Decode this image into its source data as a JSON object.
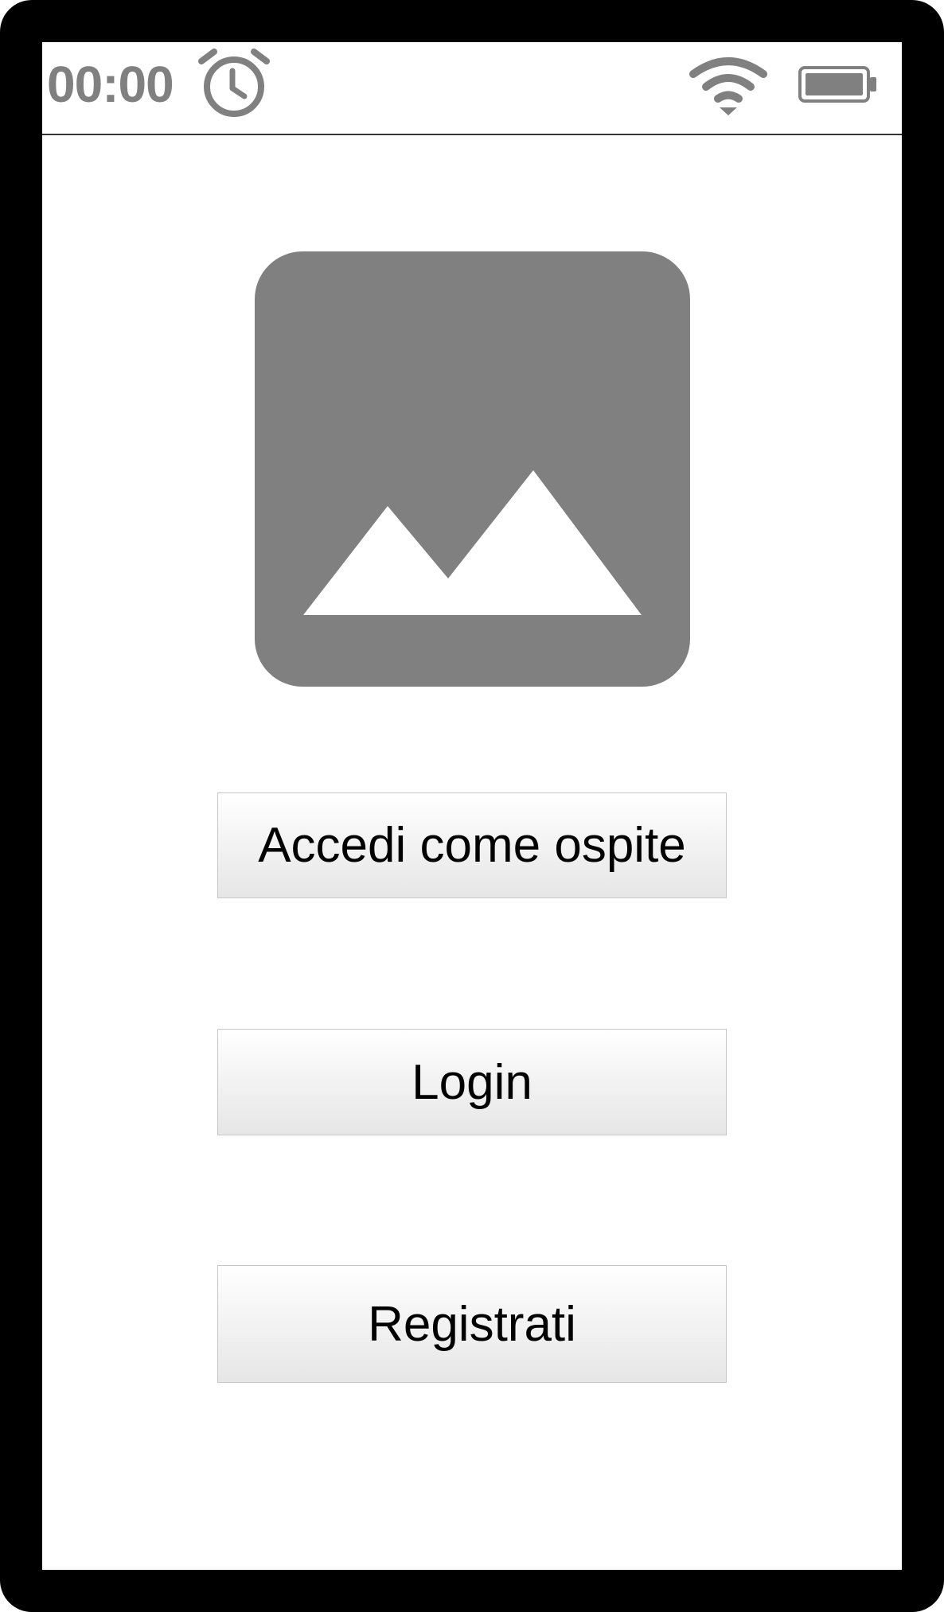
{
  "status_bar": {
    "time": "00:00",
    "icons": {
      "alarm": "alarm-clock-icon",
      "wifi": "wifi-icon",
      "battery": "battery-full-icon"
    },
    "icon_color": "#808080"
  },
  "hero": {
    "icon": "image-placeholder-icon",
    "color": "#808080"
  },
  "buttons": {
    "guest_label": "Accedi come ospite",
    "login_label": "Login",
    "register_label": "Registrati"
  },
  "colors": {
    "frame": "#000000",
    "screen": "#ffffff",
    "button_top": "#ffffff",
    "button_bottom": "#e6e6e6",
    "button_border": "#c8c8c8"
  }
}
